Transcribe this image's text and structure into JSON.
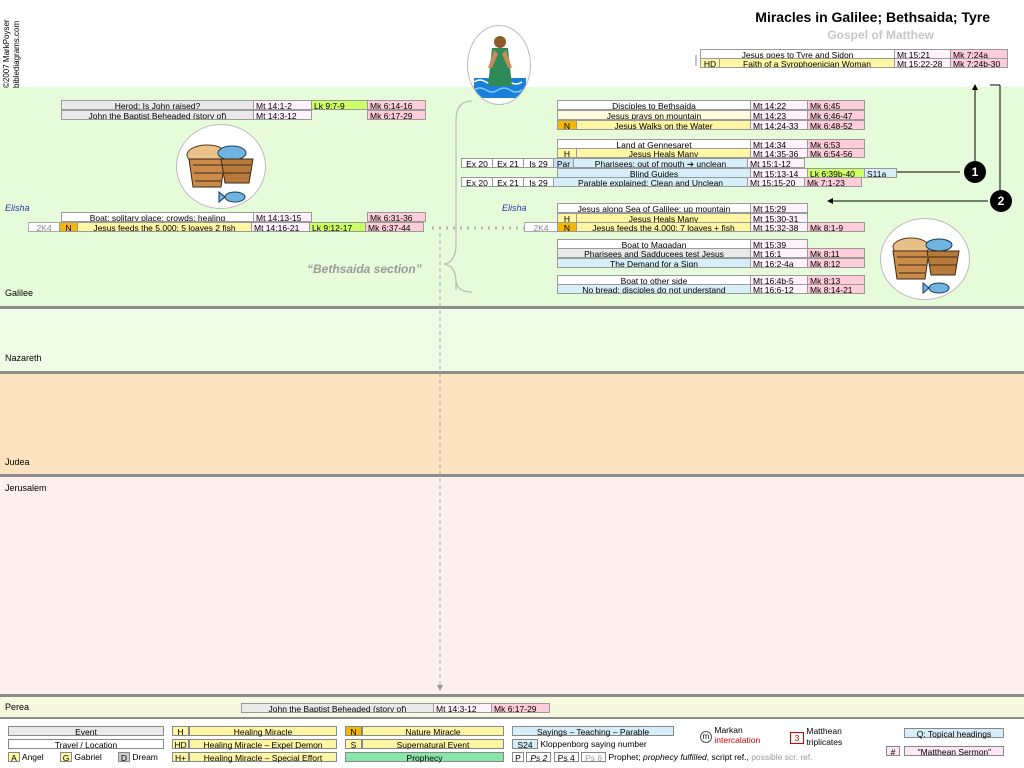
{
  "header": {
    "title": "Miracles in Galilee; Bethsaida; Tyre",
    "subtitle": "Gospel of Matthew",
    "copyright": "©2007 MarkPoyser",
    "site": "biblediagrams.com"
  },
  "regions": {
    "galilee": "Galilee",
    "nazareth": "Nazareth",
    "judea": "Judea",
    "jerusalem": "Jerusalem",
    "perea": "Perea"
  },
  "colors": {
    "galilee": "#e6fbd9",
    "nazareth": "#eefde6",
    "judea": "#fde3bf",
    "jerusalem": "#fff0f0",
    "perea": "#f6f8df",
    "event": "#e9e9e9",
    "mt": "#fff2fb",
    "mk": "#ffccd9",
    "lk": "#ccff66",
    "saying": "#d6eefa",
    "healing": "#fff6a3",
    "nature": "#f5b800",
    "prophecy": "#88e6a8"
  },
  "tyre": {
    "r1": {
      "event": "Jesus goes to Tyre and Sidon",
      "mt": "Mt 15:21",
      "mk": "Mk 7:24a"
    },
    "r2": {
      "badge": "HD",
      "event": "Faith of a Syrophoenician Woman",
      "mt": "Mt 15:22-28",
      "mk": "Mk 7:24b-30"
    }
  },
  "left": {
    "herod": {
      "event": "Herod: Is John raised?",
      "mt": "Mt 14:1-2",
      "lk": "Lk 9:7-9",
      "mk": "Mk 6:14-16"
    },
    "john": {
      "event": "John the Baptist Beheaded (story of)",
      "mt": "Mt 14:3-12",
      "mk": "Mk 6:17-29"
    },
    "boat": {
      "event": "Boat; solitary place; crowds; healing",
      "mt": "Mt 14:13-15",
      "mk": "Mk 6:31-36"
    },
    "feed5000": {
      "ot": "2K4",
      "badge": "N",
      "event": "Jesus feeds the 5,000: 5 loaves 2 fish",
      "mt": "Mt 14:16-21",
      "lk": "Lk 9:12-17",
      "mk": "Mk 6:37-44"
    },
    "elisha": "Elisha"
  },
  "right": {
    "disciples": {
      "event": "Disciples to Bethsaida",
      "mt": "Mt 14:22",
      "mk": "Mk 6:45"
    },
    "prays": {
      "event": "Jesus prays on mountain",
      "mt": "Mt 14:23",
      "mk": "Mk 6:46-47"
    },
    "walks": {
      "badge": "N",
      "event": "Jesus Walks on the Water",
      "mt": "Mt 14:24-33",
      "mk": "Mk 6:48-52"
    },
    "land": {
      "event": "Land at Gennesaret",
      "mt": "Mt 14:34",
      "mk": "Mk 6:53"
    },
    "heals": {
      "badge": "H",
      "event": "Jesus Heals Many",
      "mt": "Mt 14:35-36",
      "mk": "Mk 6:54-56"
    },
    "pharisees": {
      "ot1": "Ex 20",
      "ot2": "Ex 21",
      "ot3": "Is 29",
      "par": "Par",
      "event": "Pharisees; out of mouth ➔ unclean",
      "mt": "Mt 15:1-12"
    },
    "guides": {
      "event": "Blind Guides",
      "mt": "Mt 15:13-14",
      "lk": "Lk 6:39b-40",
      "s": "S11a"
    },
    "parable": {
      "ot1": "Ex 20",
      "ot2": "Ex 21",
      "ot3": "Is 29",
      "event": "Parable explained: Clean and Unclean",
      "mt": "Mt 15:15-20",
      "mk": "Mk 7:1-23"
    },
    "sea": {
      "event": "Jesus along Sea of Galilee; up mountain",
      "mt": "Mt 15:29"
    },
    "heals2": {
      "badge": "H",
      "event": "Jesus Heals Many",
      "mt": "Mt 15:30-31"
    },
    "feed4000": {
      "ot": "2K4",
      "badge": "N",
      "event": "Jesus feeds the 4,000: 7 loaves + fish",
      "mt": "Mt 15:32-38",
      "mk": "Mk 8:1-9"
    },
    "magadan": {
      "event": "Boat to Magadan",
      "mt": "Mt 15:39"
    },
    "sadducees": {
      "event": "Pharisees and Sadducees test Jesus",
      "mt": "Mt 16:1",
      "mk": "Mk 8:11"
    },
    "sign": {
      "event": "The Demand for a Sign",
      "mt": "Mt 16:2-4a",
      "mk": "Mk 8:12"
    },
    "otherside": {
      "event": "Boat to other side",
      "mt": "Mt 16:4b-5",
      "mk": "Mk 8:13"
    },
    "bread": {
      "event": "No bread; disciples do not understand",
      "mt": "Mt 16:6-12",
      "mk": "Mk 8:14-21"
    },
    "elisha": "Elisha"
  },
  "bethsaida_label": "“Bethsaida section”",
  "markers": {
    "one": "1",
    "two": "2"
  },
  "perea_event": {
    "event": "John the Baptist Beheaded (story of)",
    "mt": "Mt 14:3-12",
    "mk": "Mk 6:17-29"
  },
  "legend": {
    "event": "Event",
    "travel": "Travel / Location",
    "angel_code": "A",
    "angel": "Angel",
    "gabriel_code": "G",
    "gabriel": "Gabriel",
    "dream_code": "D",
    "dream": "Dream",
    "h_code": "H",
    "h_label": "Healing Miracle",
    "hd_code": "HD",
    "hd_label": "Healing Miracle – Expel Demon",
    "hp_code": "H+",
    "hp_label": "Healing Miracle – Special Effort",
    "n_code": "N",
    "n_label": "Nature Miracle",
    "s_code": "S",
    "s_label": "Supernatural Event",
    "prophecy": "Prophecy",
    "sayings": "Sayings – Teaching – Parable",
    "s24": "S24",
    "kloppenborg": "Kloppenborg saying number",
    "p": "P",
    "ps2": "Ps 2",
    "ps4": "Ps 4",
    "ps6": "Ps 6",
    "prophet_a": "Prophet; ",
    "prophet_b": "prophecy fulfilled",
    "prophet_c": ", script ref., ",
    "prophet_d": "possible scr. ref.",
    "m_code": "m",
    "markan": "Markan",
    "intercalation": "intercalation",
    "tri_code": "3",
    "matthean": "Matthean",
    "triplicates": "triplicates",
    "topical": "Q: Topical headings",
    "hash": "#",
    "sermon": "\"Matthean Sermon\""
  }
}
